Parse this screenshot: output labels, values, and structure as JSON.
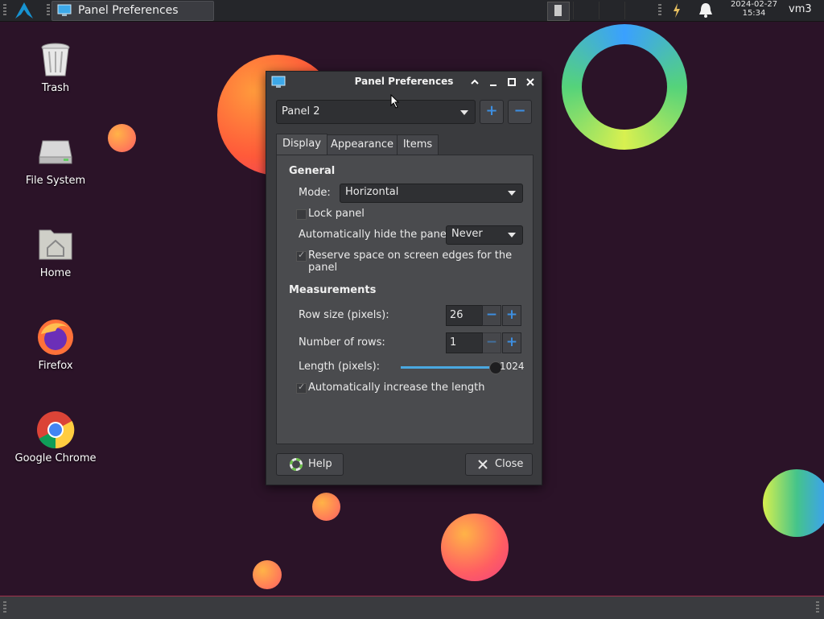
{
  "taskbar": {
    "window_button_label": "Panel Preferences",
    "clock_date": "2024-02-27",
    "clock_time": "15:34",
    "user": "vm3"
  },
  "desktop": {
    "icons": [
      {
        "label": "Trash"
      },
      {
        "label": "File System"
      },
      {
        "label": "Home"
      },
      {
        "label": "Firefox"
      },
      {
        "label": "Google Chrome"
      }
    ]
  },
  "dialog": {
    "title": "Panel Preferences",
    "panel_selector": "Panel 2",
    "add_symbol": "+",
    "remove_symbol": "−",
    "tabs": [
      {
        "label": "Display",
        "active": true
      },
      {
        "label": "Appearance",
        "active": false
      },
      {
        "label": "Items",
        "active": false
      }
    ],
    "general": {
      "heading": "General",
      "mode_label": "Mode:",
      "mode_value": "Horizontal",
      "lock_panel_label": "Lock panel",
      "lock_panel_checked": false,
      "autohide_label": "Automatically hide the panel:",
      "autohide_value": "Never",
      "reserve_space_label": "Reserve space on screen edges for the panel",
      "reserve_space_checked": true
    },
    "measurements": {
      "heading": "Measurements",
      "row_size_label": "Row size (pixels):",
      "row_size_value": "26",
      "rows_label": "Number of rows:",
      "rows_value": "1",
      "length_label": "Length (pixels):",
      "length_value": "1024",
      "length_fraction": 1.0,
      "auto_increase_label": "Automatically increase the length",
      "auto_increase_checked": true
    },
    "help_label": "Help",
    "close_label": "Close"
  },
  "colors": {
    "accent": "#3d8ee0",
    "slider_fill": "#4aa8e0"
  }
}
